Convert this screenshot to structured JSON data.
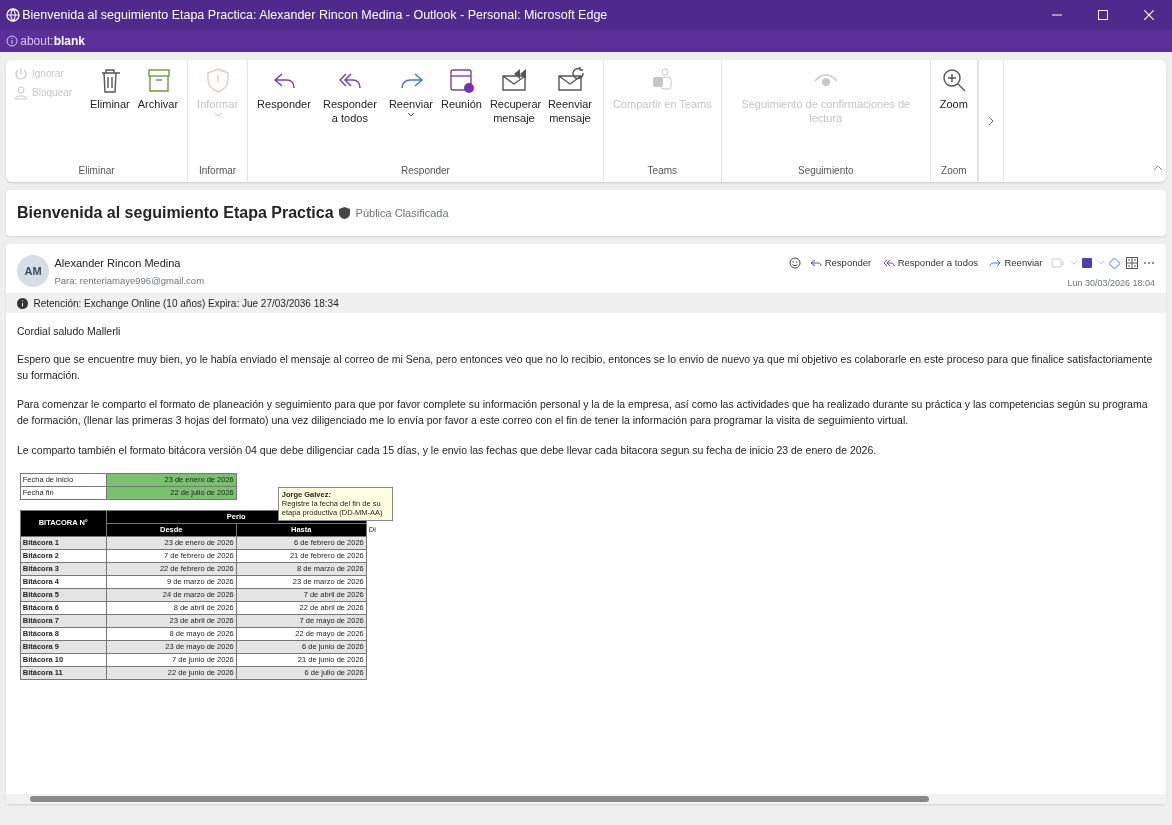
{
  "window": {
    "title": "Bienvenida al seguimiento Etapa Practica: Alexander Rincon Medina - Outlook - Personal: Microsoft Edge",
    "address": "about:**blank**"
  },
  "ribbon": {
    "groups": [
      {
        "label": "Eliminar",
        "items": [
          {
            "label": "Ignorar",
            "kind": "small",
            "disabled": true
          },
          {
            "label": "Bloquear",
            "kind": "small",
            "disabled": true
          },
          {
            "label": "Eliminar",
            "kind": "large",
            "disabled": false
          },
          {
            "label": "Archivar",
            "kind": "large",
            "disabled": false
          }
        ]
      },
      {
        "label": "Informar",
        "items": [
          {
            "label": "Informar",
            "kind": "large",
            "disabled": true,
            "has_menu": true
          }
        ]
      },
      {
        "label": "Responder",
        "items": [
          {
            "label": "Responder",
            "kind": "large",
            "disabled": false
          },
          {
            "label": "Responder a todos",
            "kind": "large",
            "disabled": false
          },
          {
            "label": "Reenviar",
            "kind": "large",
            "disabled": false,
            "has_menu": true
          },
          {
            "label": "Reunión",
            "kind": "large",
            "disabled": false
          },
          {
            "label": "Recuperar mensaje",
            "kind": "large",
            "disabled": false
          },
          {
            "label": "Reenviar mensaje",
            "kind": "large",
            "disabled": false
          }
        ]
      },
      {
        "label": "Teams",
        "items": [
          {
            "label": "Compartir en Teams",
            "kind": "large",
            "disabled": true
          }
        ]
      },
      {
        "label": "Seguimiento",
        "items": [
          {
            "label": "Seguimiento de confirmaciones de lectura",
            "kind": "large",
            "disabled": true
          }
        ]
      },
      {
        "label": "Zoom",
        "items": [
          {
            "label": "Zoom",
            "kind": "large",
            "disabled": false
          }
        ]
      }
    ]
  },
  "subject": {
    "title": "Bienvenida al seguimiento Etapa Practica",
    "sensitivity": "Pública Clasificada"
  },
  "message": {
    "avatar": "AM",
    "sender": "Alexander Rincon Medina",
    "to_label": "Para:",
    "to": "renteriamaye996@gmail.com",
    "actions": [
      {
        "label": "Responder"
      },
      {
        "label": "Responder a todos"
      },
      {
        "label": "Reenviar"
      }
    ],
    "date": "Lun 30/03/2026 18:04",
    "retention": "Retención: Exchange Online (10 años) Expira: Jue 27/03/2036 18:34",
    "body": [
      "Cordial saludo Mallerli",
      "Espero que se encuentre muy bien, yo le había enviado el mensaje al correo de mi Sena, pero entonces veo que no lo recibio, entonces se lo envio de nuevo ya que mi objetivo es colaborarle en este proceso para que finalice satisfactoriamente su formación.",
      "Para comenzar le comparto el formato de planeación y seguimiento para que por favor complete su información personal y la de la empresa, así como las actividades que ha realizado durante su práctica y las competencias según su programa de formación, (llenar las primeras 3 hojas del formato) una vez diligenciado me lo envía por favor a este correo con el fin de tener la información para programar la visita de seguimiento virtual.",
      "Le comparto también el formato bitácora versión 04 que debe diligenciar cada 15 días, y le envio las fechas que debe llevar cada bitacora segun su fecha de inicio 23 de enero de 2026."
    ]
  },
  "spreadsheet": {
    "fields": [
      {
        "label": "Fecha de inicio",
        "value": "23 de enero de 2026"
      },
      {
        "label": "Fecha fin",
        "value": "22 de julio de 2026"
      }
    ],
    "comment": {
      "author": "Jorge Galvez:",
      "text": "Registre la fecha del fin de su etapa productiva (DD-MM-AA)"
    },
    "columns": {
      "first": "BITACORA N°",
      "group": "Perio",
      "from": "Desde",
      "to": "Hasta",
      "extra": "Di"
    },
    "rows": [
      [
        "Bitácora 1",
        "23 de enero de 2026",
        "6 de febrero de 2026"
      ],
      [
        "Bitácora 2",
        "7 de febrero de 2026",
        "21 de febrero de 2026"
      ],
      [
        "Bitácora 3",
        "22 de febrero de 2026",
        "8 de marzo de 2026"
      ],
      [
        "Bitácora 4",
        "9 de marzo de 2026",
        "23 de marzo de 2026"
      ],
      [
        "Bitácora 5",
        "24 de marzo de 2026",
        "7 de abril de 2026"
      ],
      [
        "Bitácora 6",
        "8 de abril de 2026",
        "22 de abril de 2026"
      ],
      [
        "Bitácora 7",
        "23 de abril de 2026",
        "7 de mayo de 2026"
      ],
      [
        "Bitácora 8",
        "8 de mayo de 2026",
        "22 de mayo de 2026"
      ],
      [
        "Bitácora 9",
        "23 de mayo de 2026",
        "6 de junio de 2026"
      ],
      [
        "Bitácora 10",
        "7 de junio de 2026",
        "21 de junio de 2026"
      ],
      [
        "Bitácora 11",
        "22 de junio de 2026",
        "6 de julio de 2026"
      ]
    ]
  }
}
